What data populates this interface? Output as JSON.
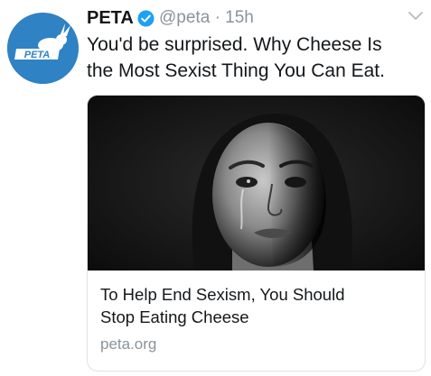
{
  "tweet": {
    "author_name": "PETA",
    "handle": "@peta",
    "separator": "·",
    "time": "15h",
    "text_lines": [
      "You'd be surprised. Why Cheese Is",
      "the Most Sexist Thing You Can Eat."
    ],
    "avatar_logo_text": "PETA",
    "verified": true
  },
  "card": {
    "image": "crying-woman-photo",
    "title_lines": [
      "To Help End Sexism, You Should",
      "Stop Eating Cheese"
    ],
    "domain": "peta.org"
  },
  "colors": {
    "avatar_bg": "#2f82c3",
    "verified_badge": "#1da1f2",
    "secondary_text": "#8a939b",
    "card_border": "#dde3e8"
  }
}
